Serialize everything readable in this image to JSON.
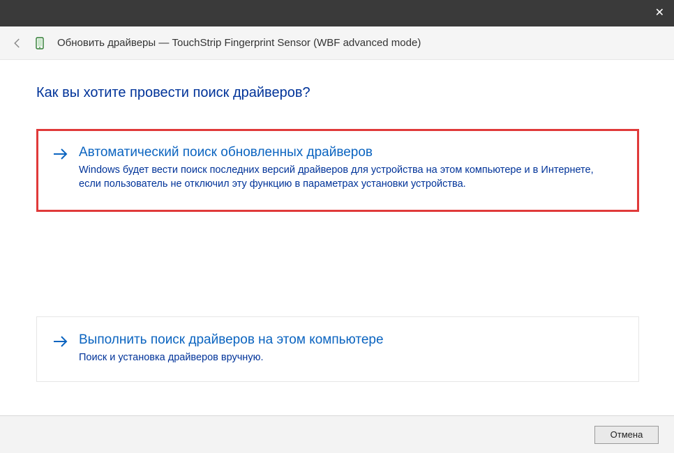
{
  "titlebar": {
    "close_glyph": "✕"
  },
  "header": {
    "title": "Обновить драйверы — TouchStrip Fingerprint Sensor (WBF advanced mode)"
  },
  "heading": "Как вы хотите провести поиск драйверов?",
  "options": [
    {
      "title": "Автоматический поиск обновленных драйверов",
      "desc": "Windows будет вести поиск последних версий драйверов для устройства на этом компьютере и в Интернете, если пользователь не отключил эту функцию в параметрах установки устройства.",
      "highlighted": true
    },
    {
      "title": "Выполнить поиск драйверов на этом компьютере",
      "desc": "Поиск и установка драйверов вручную.",
      "highlighted": false
    }
  ],
  "footer": {
    "cancel_label": "Отмена"
  }
}
